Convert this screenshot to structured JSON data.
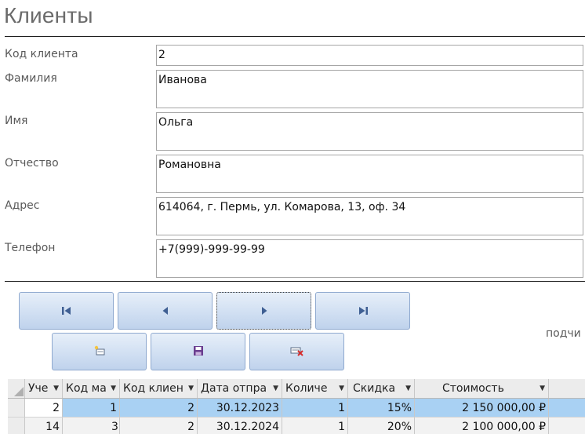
{
  "form": {
    "title": "Клиенты",
    "fields": [
      {
        "label": "Код клиента",
        "value": "2"
      },
      {
        "label": "Фамилия",
        "value": "Иванова"
      },
      {
        "label": "Имя",
        "value": "Ольга"
      },
      {
        "label": "Отчество",
        "value": "Романовна"
      },
      {
        "label": "Адрес",
        "value": "614064, г. Пермь, ул. Комарова, 13, оф. 34"
      },
      {
        "label": "Телефон",
        "value": "+7(999)-999-99-99"
      }
    ]
  },
  "nav_buttons": [
    "first-record-icon",
    "previous-record-icon",
    "next-record-icon",
    "last-record-icon"
  ],
  "action_buttons": [
    "new-record-icon",
    "save-record-icon",
    "delete-record-icon"
  ],
  "subform_label": "подчи",
  "grid": {
    "columns": [
      "Уче",
      "Код ма",
      "Код клиен",
      "Дата отпра",
      "Количе",
      "Скидка",
      "Стоимость"
    ],
    "rows": [
      [
        "2",
        "1",
        "2",
        "30.12.2023",
        "1",
        "15%",
        "2 150 000,00 ₽"
      ],
      [
        "14",
        "3",
        "2",
        "30.12.2024",
        "1",
        "20%",
        "2 100 000,00 ₽"
      ]
    ]
  },
  "colors": {
    "accent": "#a9d1f3",
    "button_gradient_top": "#e7eff9",
    "button_gradient_bottom": "#bfd2ec",
    "icon_blue": "#3f5f93",
    "save_purple": "#6a3d8f",
    "delete_red": "#d62c2c"
  }
}
